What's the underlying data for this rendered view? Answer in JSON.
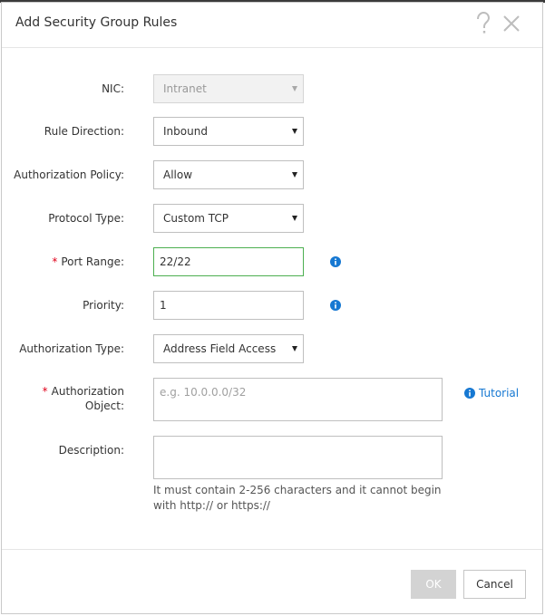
{
  "dialog": {
    "title": "Add Security Group Rules",
    "help_icon": "question-mark-icon",
    "close_icon": "close-icon"
  },
  "form": {
    "nic": {
      "label": "NIC:",
      "value": "Intranet",
      "disabled": true
    },
    "rule_direction": {
      "label": "Rule Direction:",
      "value": "Inbound"
    },
    "authorization_policy": {
      "label": "Authorization Policy:",
      "value": "Allow"
    },
    "protocol_type": {
      "label": "Protocol Type:",
      "value": "Custom TCP"
    },
    "port_range": {
      "label": "Port Range:",
      "required_mark": "*",
      "value": "22/22",
      "info_icon": "info-icon"
    },
    "priority": {
      "label": "Priority:",
      "value": "1",
      "info_icon": "info-icon"
    },
    "authorization_type": {
      "label": "Authorization Type:",
      "value": "Address Field Access"
    },
    "authorization_object": {
      "label_line1": "Authorization",
      "label_line2": "Object:",
      "required_mark": "*",
      "placeholder": "e.g. 10.0.0.0/32",
      "tutorial_label": "Tutorial"
    },
    "description": {
      "label": "Description:",
      "value": "",
      "hint": "It must contain 2-256 characters and it cannot begin with http:// or https://"
    }
  },
  "footer": {
    "ok_label": "OK",
    "cancel_label": "Cancel"
  },
  "colors": {
    "required": "#e0001a",
    "link": "#1678d2",
    "focus_border": "#4caf50",
    "ok_disabled": "#d3d3d3"
  }
}
